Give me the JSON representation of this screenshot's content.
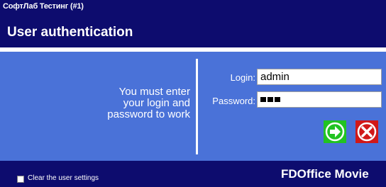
{
  "window": {
    "title": "СофтЛаб Тестинг (#1)"
  },
  "header": {
    "heading": "User authentication"
  },
  "main": {
    "message_lines": [
      "You must enter",
      "your login and",
      "password to work"
    ],
    "login_label": "Login:",
    "login_value": "admin",
    "password_label": "Password:",
    "password_dot_count": 3,
    "ok_icon": "arrow-right-icon",
    "cancel_icon": "close-circle-icon"
  },
  "footer": {
    "checkbox_label": "Clear the user settings",
    "checkbox_checked": false,
    "brand": "FDOffice Movie"
  },
  "colors": {
    "navy": "#0d0c6e",
    "panel_blue": "#4a72d8",
    "ok_green": "#22c322",
    "cancel_red": "#d11818"
  }
}
